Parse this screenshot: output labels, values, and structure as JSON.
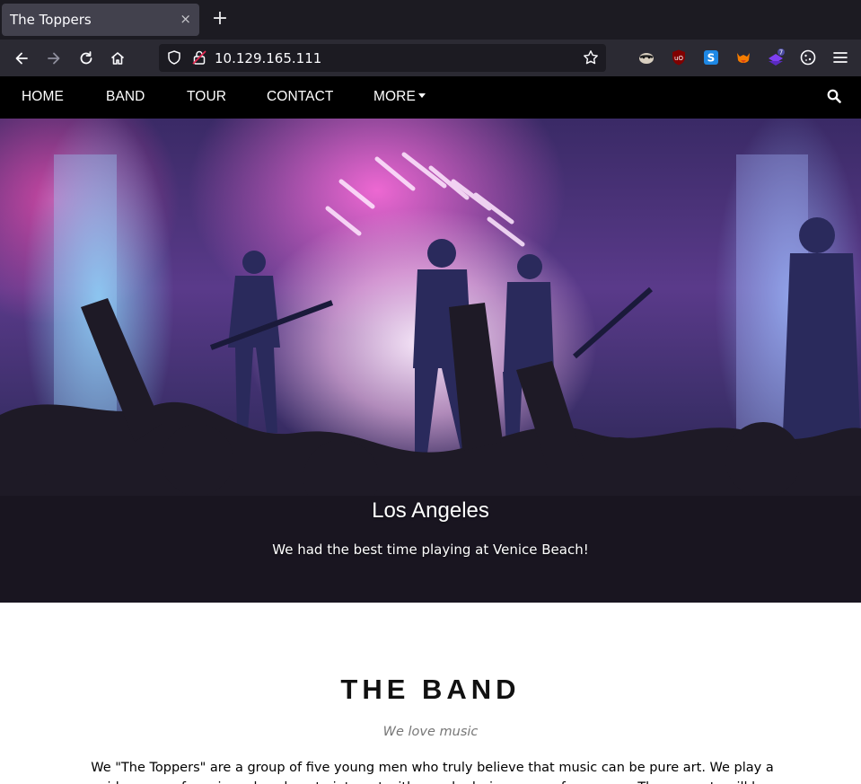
{
  "browser": {
    "tab_title": "The Toppers",
    "tab_close": "×",
    "new_tab": "+",
    "url": "10.129.165.111",
    "extension_badge": "7",
    "extensions": [
      "privacy-badger-icon",
      "ublock-origin-icon",
      "s-extension-icon",
      "foxyproxy-icon",
      "wappalyzer-icon",
      "cookie-editor-icon"
    ]
  },
  "site_nav": {
    "items": [
      "HOME",
      "BAND",
      "TOUR",
      "CONTACT",
      "MORE"
    ]
  },
  "hero": {
    "city": "Los Angeles",
    "caption": "We had the best time playing at Venice Beach!"
  },
  "band": {
    "title": "THE BAND",
    "tagline": "We love music",
    "body": "We \"The Toppers\" are a group of five young men who truly believe that music can be pure art. We play a wide range of music and we love to interact with people during our performances. The concerts will be the loudest, the most beautiful"
  },
  "colors": {
    "tabbar_bg": "#1c1b22",
    "toolbar_bg": "#2b2a33",
    "site_nav_bg": "#000000",
    "heading": "#111111",
    "tagline": "#777777"
  }
}
